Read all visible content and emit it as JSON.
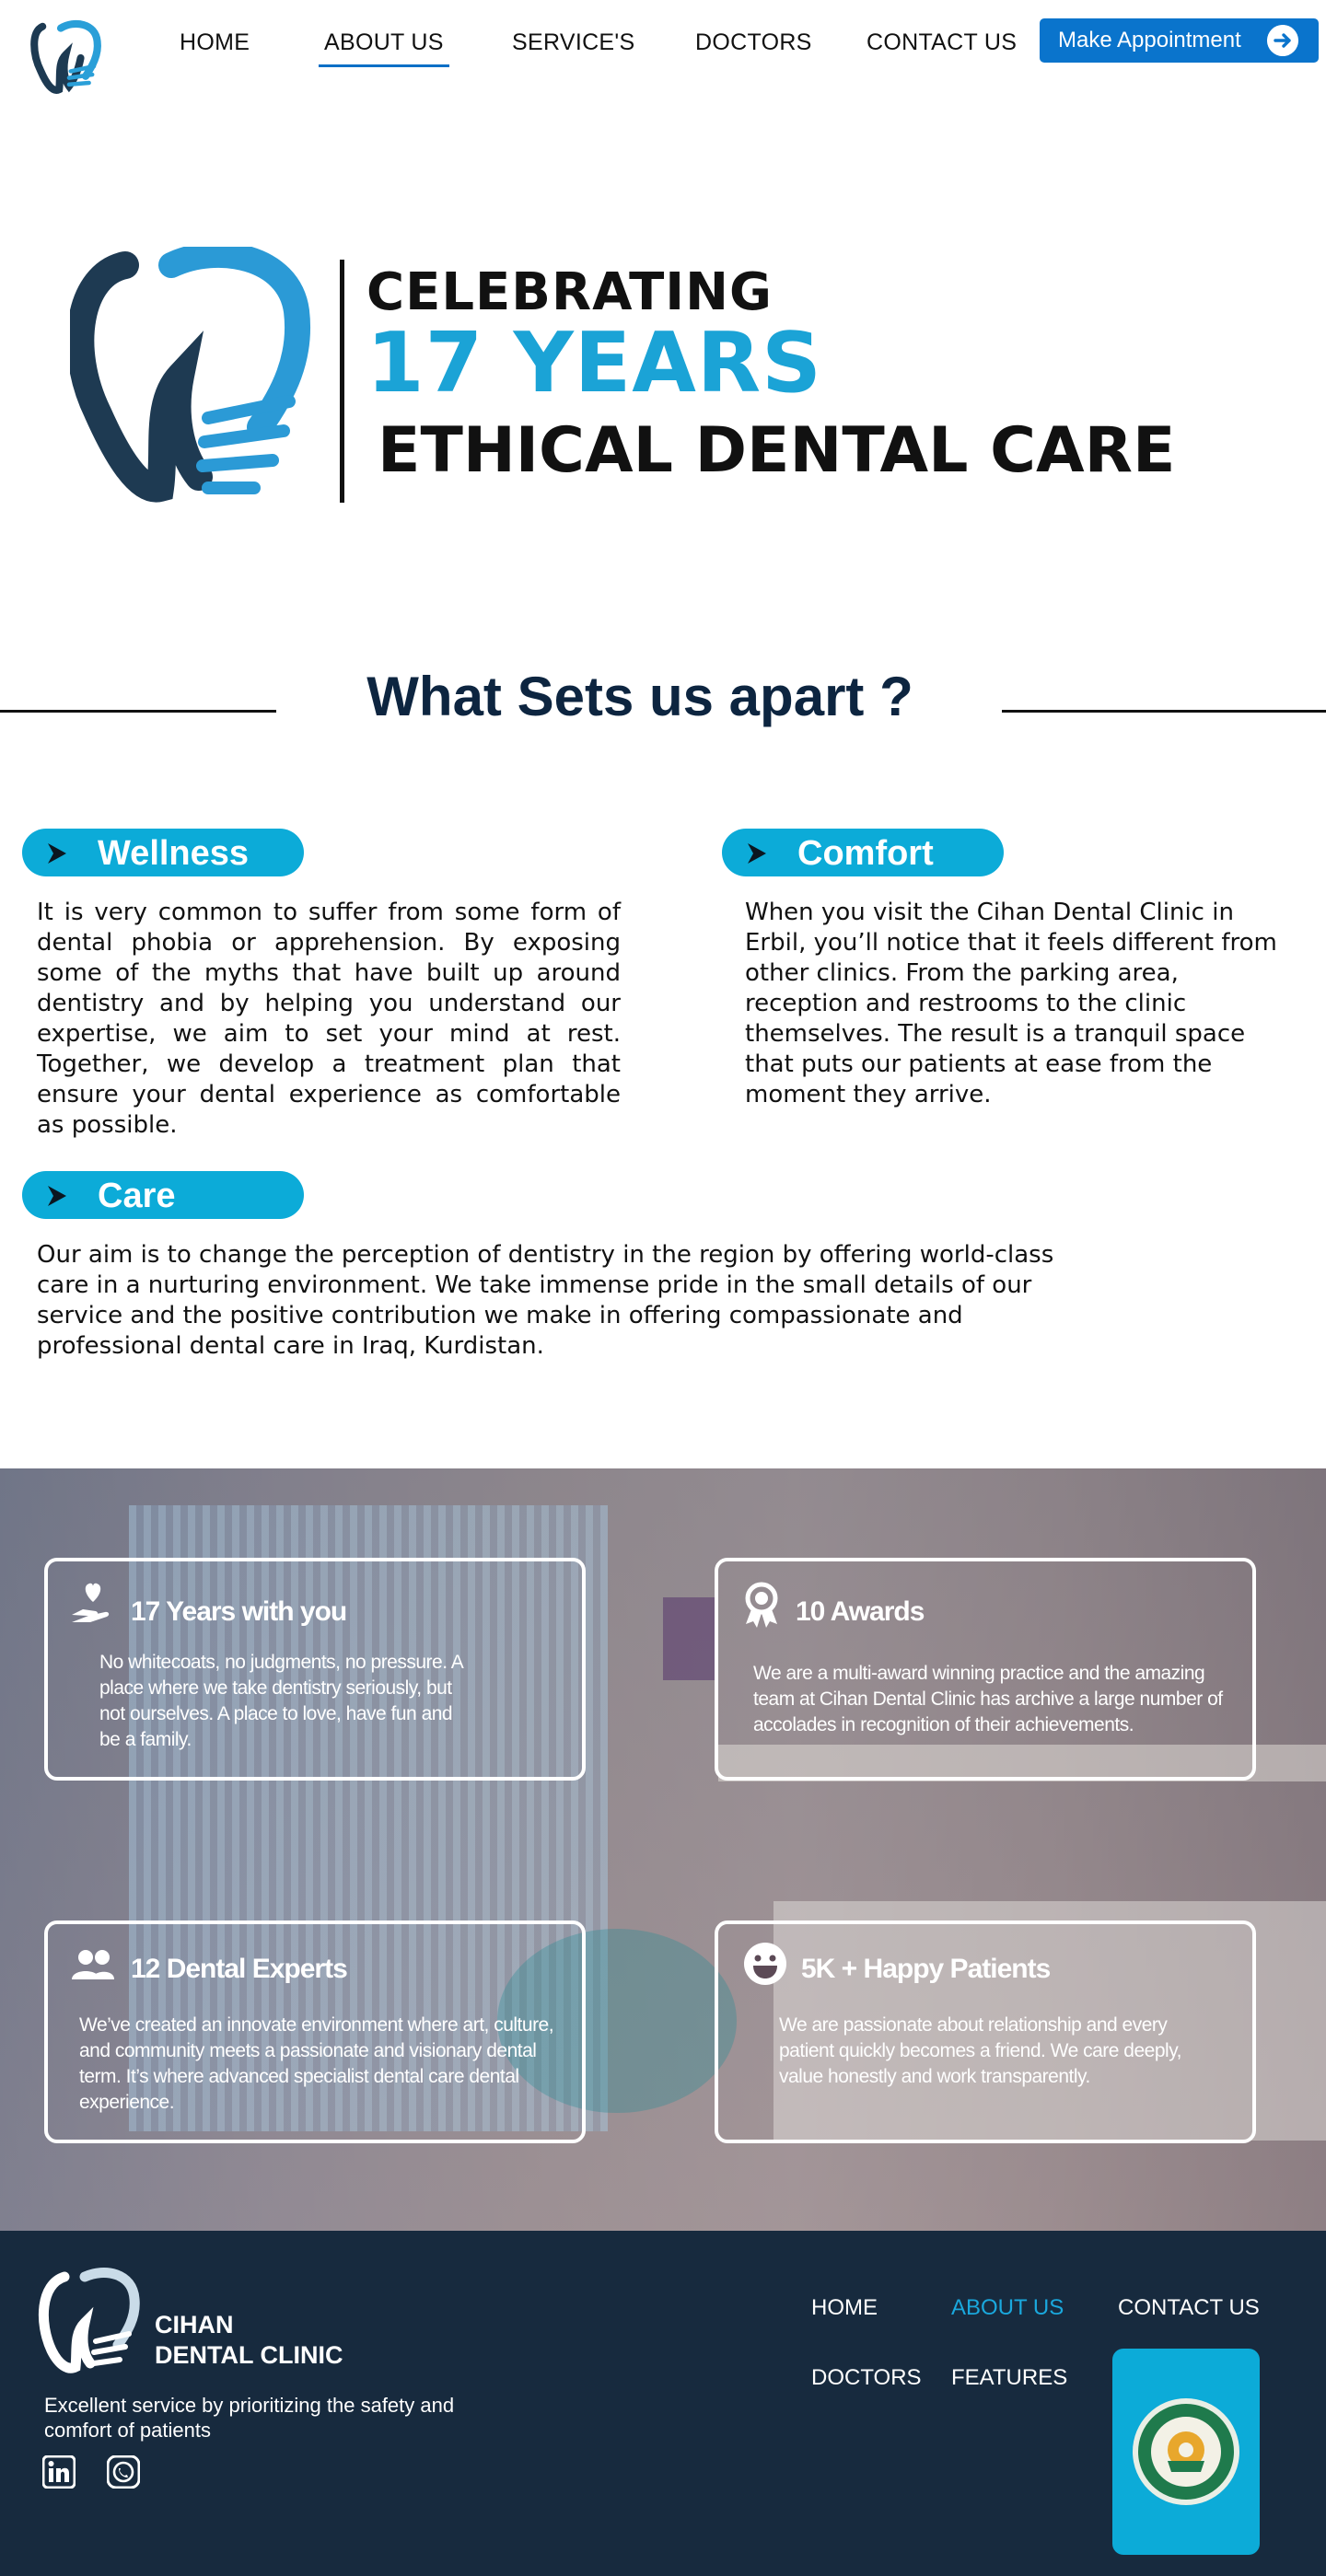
{
  "nav": {
    "items": [
      {
        "label": "HOME",
        "active": false
      },
      {
        "label": "ABOUT US",
        "active": true
      },
      {
        "label": "SERVICE'S",
        "active": false
      },
      {
        "label": "DOCTORS",
        "active": false
      },
      {
        "label": "CONTACT US",
        "active": false
      }
    ],
    "cta_label": "Make Appointment",
    "logo_icon": "tooth-logo-icon",
    "cta_icon": "arrow-right-circle-icon"
  },
  "hero": {
    "line1": "CELEBRATING",
    "line2": "17 YEARS",
    "line3": "ETHICAL DENTAL CARE"
  },
  "section": {
    "title": "What Sets us apart ?"
  },
  "features": [
    {
      "title": "Wellness",
      "text": "It is very common to suffer from some form of dental phobia or apprehension. By exposing some of the myths that have built up around dentistry and by helping you understand our expertise, we aim to set your mind at rest. Together, we develop a treatment plan that ensure your dental experience as comfortable as possible."
    },
    {
      "title": "Comfort",
      "text": "When you visit the Cihan Dental Clinic in Erbil, you’ll notice that it feels different from other clinics. From  the parking area, reception and restrooms to the clinic themselves. The result is a tranquil space that puts our patients at ease from the moment they arrive."
    },
    {
      "title": "Care",
      "text": "Our aim is to change the perception of dentistry in the region by offering world-class care in a nurturing environment. We take immense pride in the small details of our service and the positive contribution we make in offering compassionate and professional dental care in Iraq, Kurdistan."
    }
  ],
  "stats": [
    {
      "title": "17 Years with you",
      "icon": "heart-hand-icon",
      "text": "No whitecoats, no judgments, no pressure. A place where we take dentistry seriously, but not ourselves. A place to love, have fun and be a family."
    },
    {
      "title": "10 Awards",
      "icon": "award-ribbon-icon",
      "text": "We are a multi-award winning practice and the amazing team at Cihan Dental Clinic has archive a large number of accolades in recognition of their achievements."
    },
    {
      "title": "12 Dental Experts",
      "icon": "users-group-icon",
      "text": "We’ve created an innovate environment where art, culture, and community meets a passionate and visionary dental term. It’s where advanced specialist dental care  dental experience."
    },
    {
      "title": "5K + Happy Patients",
      "icon": "smile-face-icon",
      "text": "We are passionate about relationship and every patient quickly becomes a friend. We care deeply, value honestly and work transparently."
    }
  ],
  "footer": {
    "brand_line1": "CIHAN",
    "brand_line2": "DENTAL CLINIC",
    "tagline": "Excellent service by prioritizing the safety and comfort of patients",
    "links": [
      {
        "label": "HOME",
        "active": false
      },
      {
        "label": "ABOUT US",
        "active": true
      },
      {
        "label": "CONTACT US",
        "active": false
      },
      {
        "label": "DOCTORS",
        "active": false
      },
      {
        "label": "FEATURES",
        "active": false
      }
    ],
    "social_icons": [
      "linkedin-icon",
      "whatsapp-icon"
    ],
    "seal_icon": "cihan-university-seal-icon"
  },
  "colors": {
    "accent": "#0cabd8",
    "button": "#0a74cc",
    "navy": "#0d2540",
    "footer_bg": "#172a3e"
  }
}
